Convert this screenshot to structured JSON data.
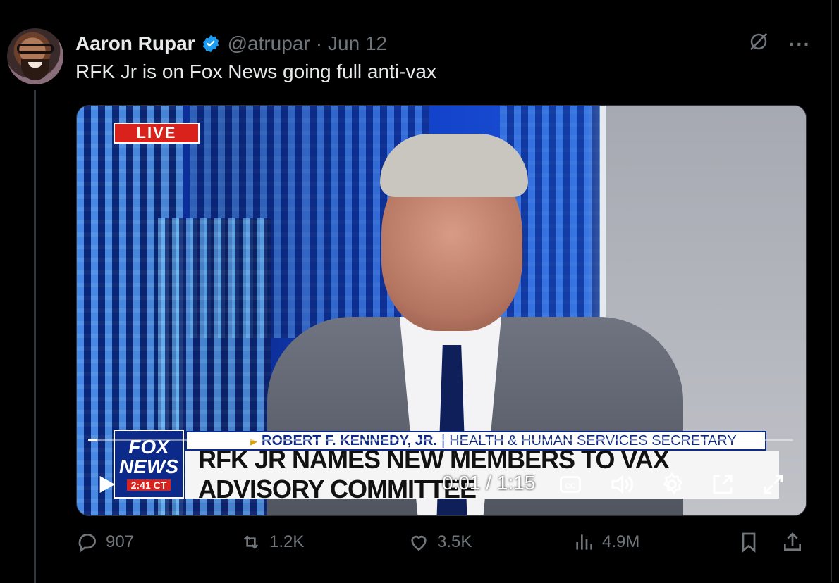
{
  "tweet": {
    "author_name": "Aaron Rupar",
    "handle": "@atrupar",
    "separator": "·",
    "date": "Jun 12",
    "text": "RFK Jr is on Fox News going full anti-vax",
    "verified": true
  },
  "top_actions": {
    "grok_icon": "grok-icon",
    "more_label": "···"
  },
  "video": {
    "live_badge": "LIVE",
    "fox_logo_line1": "FOX",
    "fox_logo_line2": "NEWS",
    "fox_time": "2:41 CT",
    "chyron_name": "ROBERT F. KENNEDY, JR.",
    "chyron_sep": "|",
    "chyron_role": "HEALTH & HUMAN SERVICES SECRETARY",
    "chyron_headline": "RFK JR NAMES NEW MEMBERS TO VAX ADVISORY COMMITTEE",
    "timecode": "0:01 / 1:15",
    "progress_fraction": 0.013,
    "icons": [
      "play-icon",
      "captions-icon",
      "volume-icon",
      "settings-icon",
      "pip-icon",
      "fullscreen-icon"
    ]
  },
  "metrics": {
    "replies": "907",
    "reposts": "1.2K",
    "likes": "3.5K",
    "views": "4.9M"
  },
  "colors": {
    "background": "#000000",
    "text_primary": "#e7e9ea",
    "text_secondary": "#71767b",
    "verified_blue": "#1d9bf0",
    "live_red": "#d9221b",
    "fox_blue": "#0b2a8a"
  }
}
